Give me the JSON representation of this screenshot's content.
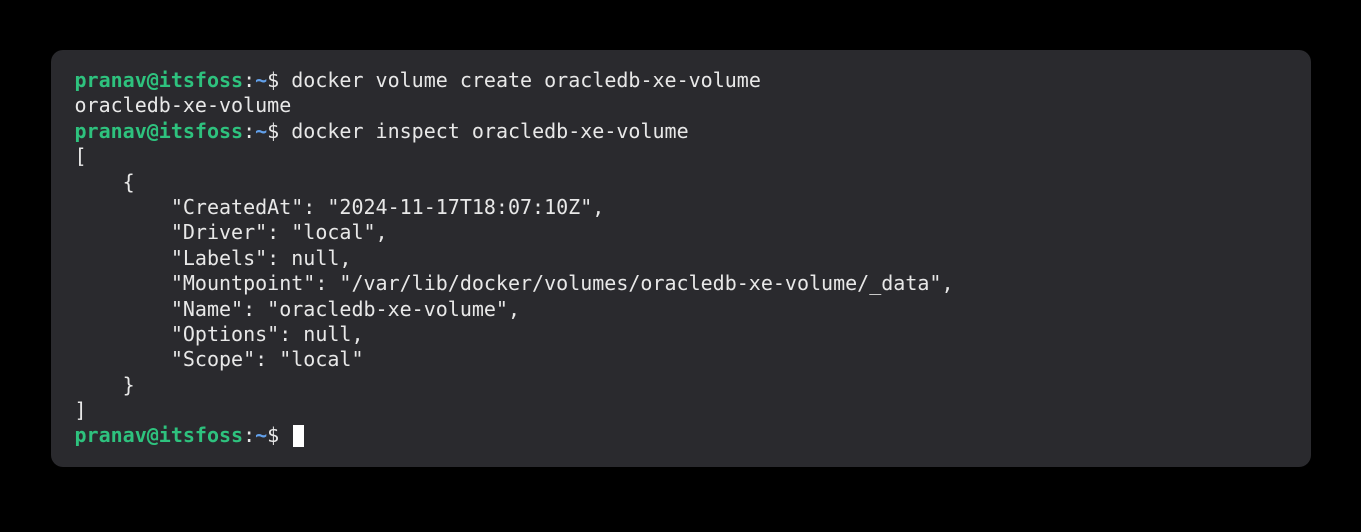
{
  "prompt": {
    "user_host": "pranav@itsfoss",
    "colon": ":",
    "path": "~",
    "symbol": "$ "
  },
  "session": {
    "entry1": {
      "command": "docker volume create oracledb-xe-volume",
      "output": "oracledb-xe-volume"
    },
    "entry2": {
      "command": "docker inspect oracledb-xe-volume",
      "output_lines": [
        "[",
        "    {",
        "        \"CreatedAt\": \"2024-11-17T18:07:10Z\",",
        "        \"Driver\": \"local\",",
        "        \"Labels\": null,",
        "        \"Mountpoint\": \"/var/lib/docker/volumes/oracledb-xe-volume/_data\",",
        "        \"Name\": \"oracledb-xe-volume\",",
        "        \"Options\": null,",
        "        \"Scope\": \"local\"",
        "    }",
        "]"
      ]
    }
  }
}
